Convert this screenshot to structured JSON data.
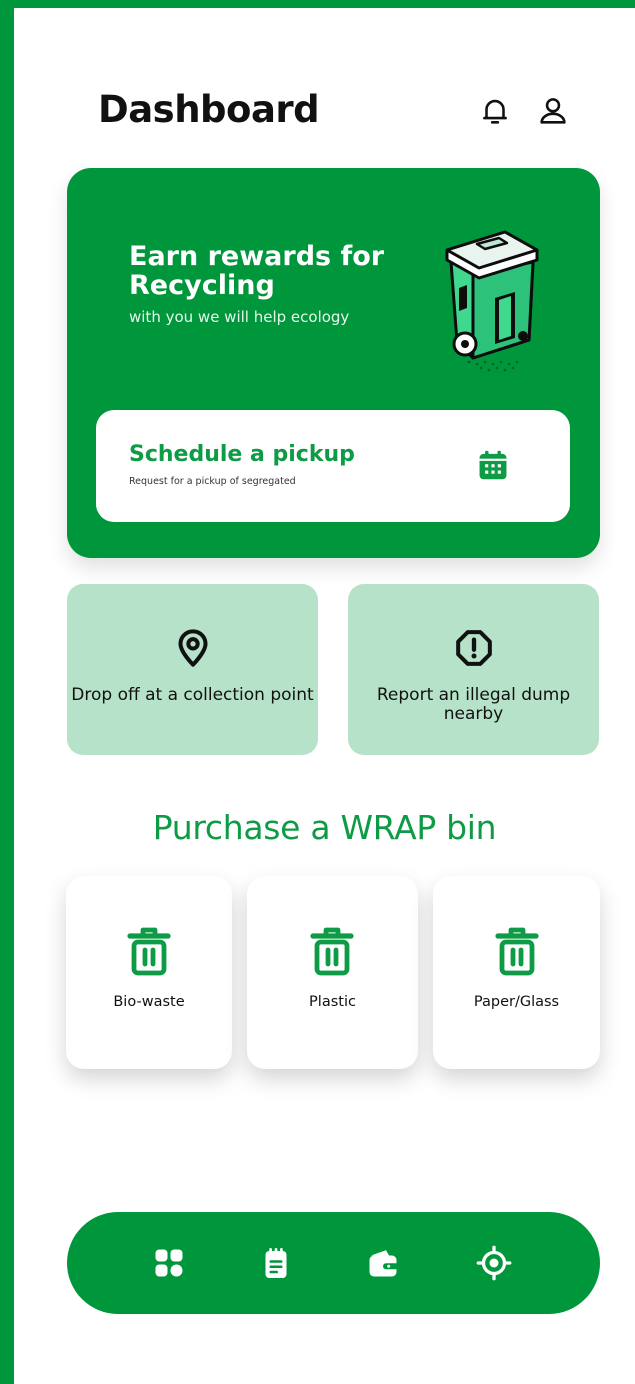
{
  "header": {
    "title": "Dashboard",
    "icons": [
      "bell-icon",
      "user-icon"
    ]
  },
  "hero": {
    "title": "Earn rewards for Recycling",
    "subtitle": "with you we will help ecology",
    "pickup": {
      "title": "Schedule a pickup",
      "subtitle": "Request for a pickup of segregated",
      "icon": "calendar-icon"
    }
  },
  "actions": [
    {
      "label": "Drop off at a collection point",
      "icon": "map-pin-icon"
    },
    {
      "label": "Report an illegal dump nearby",
      "icon": "alert-icon"
    }
  ],
  "purchase": {
    "title": "Purchase a WRAP bin",
    "bins": [
      {
        "label": "Bio-waste",
        "icon": "trash-bin-icon"
      },
      {
        "label": "Plastic",
        "icon": "trash-bin-icon"
      },
      {
        "label": "Paper/Glass",
        "icon": "trash-bin-icon"
      }
    ]
  },
  "nav": {
    "items": [
      "grid-icon",
      "notes-icon",
      "wallet-icon",
      "location-target-icon"
    ]
  },
  "colors": {
    "brand": "#00963c",
    "accent_text": "#0e9b45",
    "action_bg": "#b5e2c8"
  }
}
